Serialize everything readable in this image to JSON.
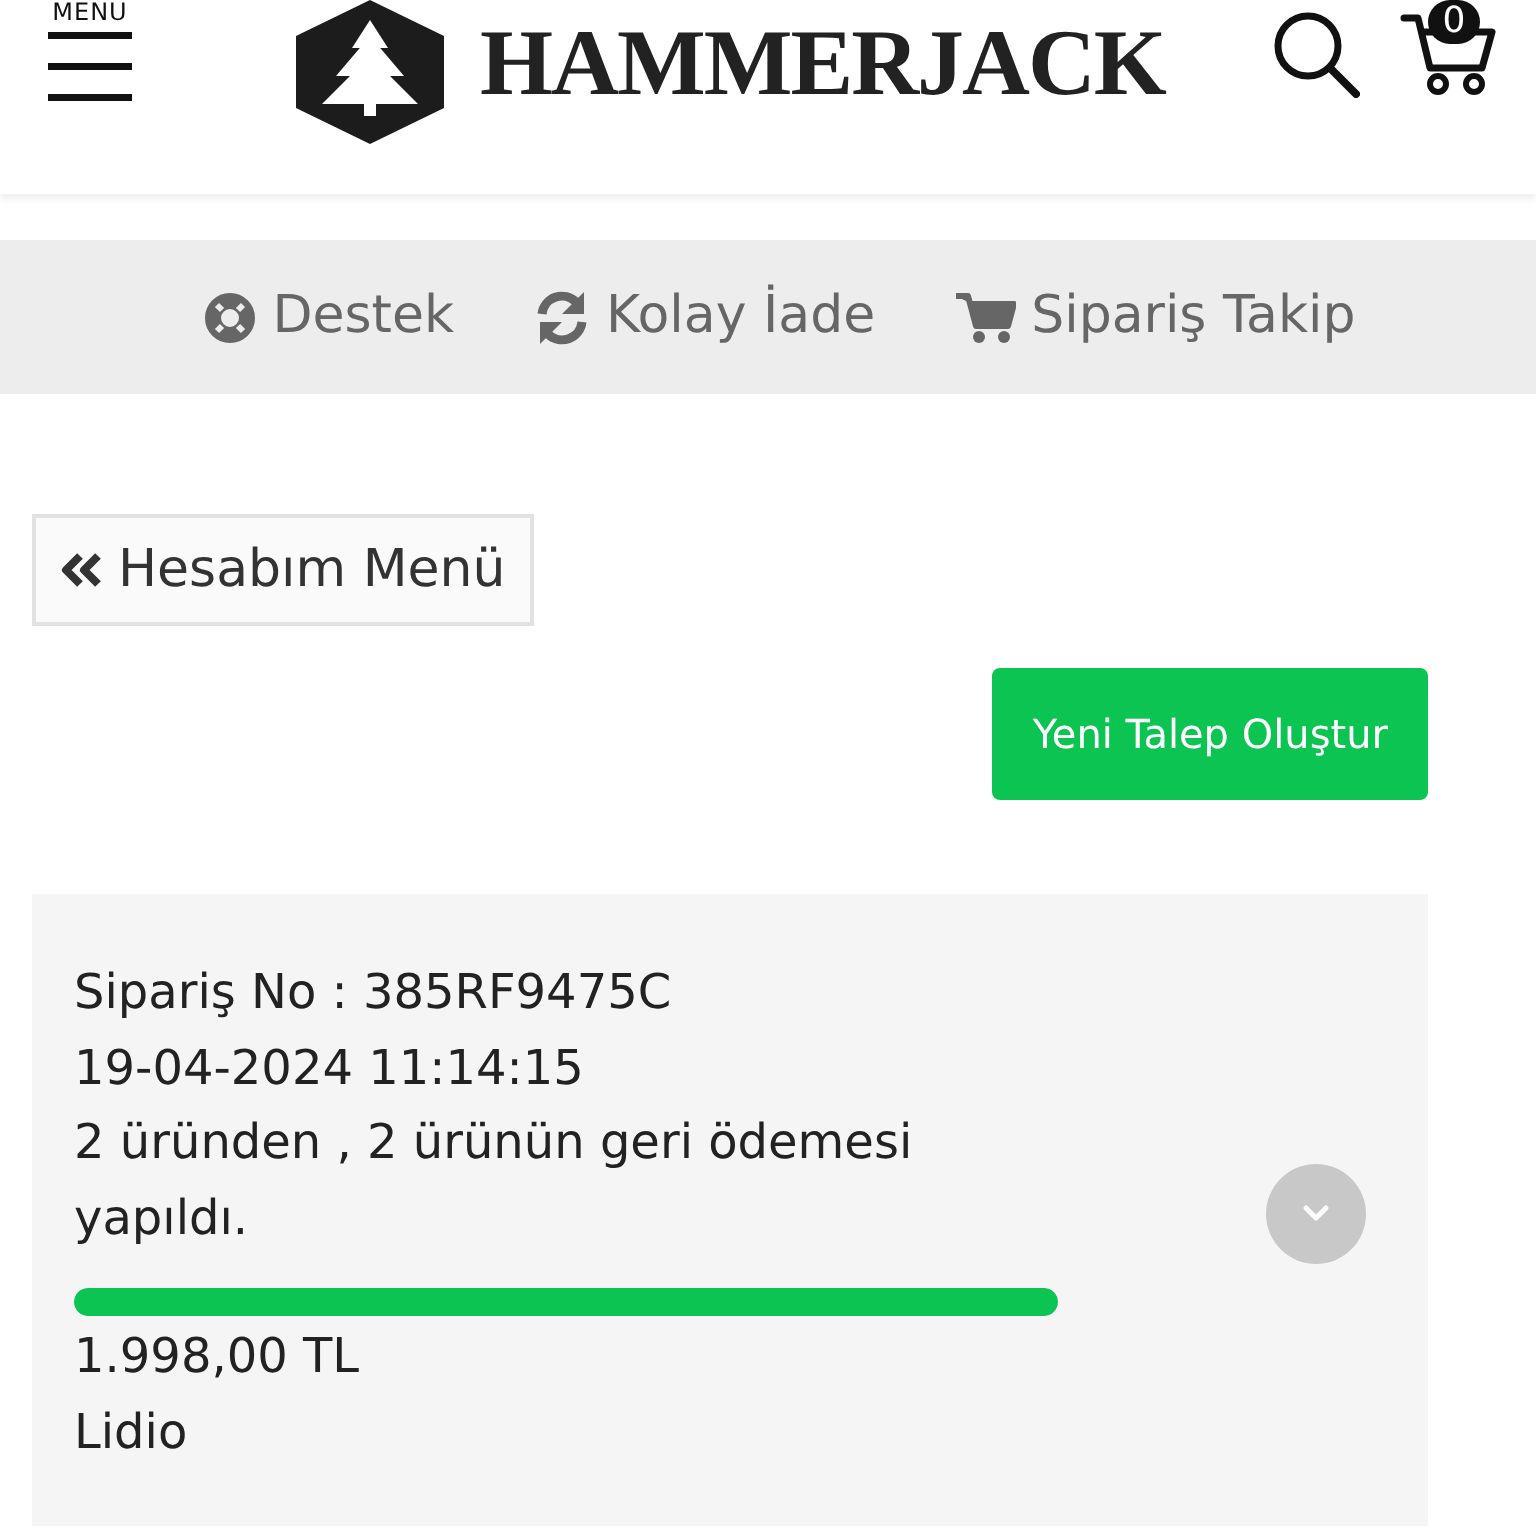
{
  "header": {
    "menu_label": "MENU",
    "logo_text": "HAMMERJACK",
    "cart_count": "0"
  },
  "nav": [
    {
      "kind": "support",
      "label": "Destek"
    },
    {
      "kind": "returns",
      "label": "Kolay İade"
    },
    {
      "kind": "tracking",
      "label": "Sipariş Takip"
    }
  ],
  "back_button": {
    "label": "Hesabım Menü"
  },
  "new_request_button": {
    "label": "Yeni Talep Oluştur"
  },
  "orders": [
    {
      "order_no": "Sipariş No : 385RF9475C",
      "date": "19-04-2024 11:14:15",
      "status": "2 üründen , 2 ürünün geri ödemesi yapıldı.",
      "level": 1,
      "amount": "1.998,00 TL",
      "payment": "Lidio",
      "expanded": false
    }
  ]
}
